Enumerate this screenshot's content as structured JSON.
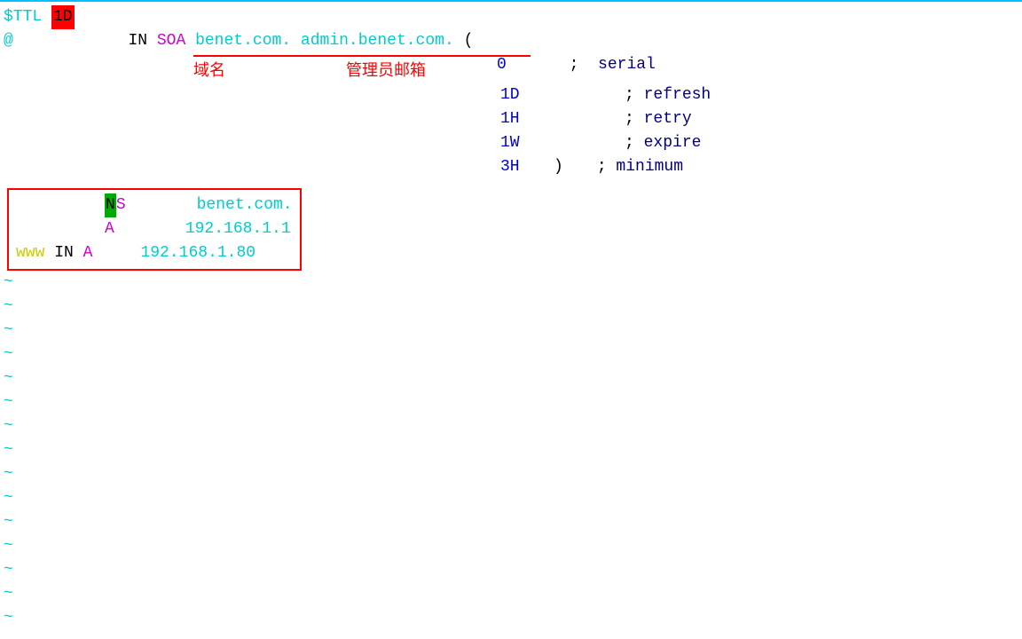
{
  "editor": {
    "border_color": "#00bfff",
    "ttl": {
      "directive": "$TTL",
      "value": "1D"
    },
    "soa": {
      "at": "@",
      "class": "IN",
      "type": "SOA",
      "domain": "benet.com.",
      "admin": "admin.benet.com.",
      "paren_open": "(",
      "annotation_domain": "域名",
      "annotation_email": "管理员邮箱"
    },
    "soa_params": [
      {
        "value": "0",
        "comment": "serial"
      },
      {
        "value": "1D",
        "comment": "refresh"
      },
      {
        "value": "1H",
        "comment": "retry"
      },
      {
        "value": "1W",
        "comment": "expire"
      },
      {
        "value": "3H",
        "paren_close": ")",
        "comment": "minimum"
      }
    ],
    "records": [
      {
        "name": "",
        "class": "",
        "type": "NS",
        "data": "benet.com.",
        "highlight_n": true
      },
      {
        "name": "",
        "class": "",
        "type": "A",
        "data": "192.168.1.1",
        "highlight_n": false
      },
      {
        "name": "www",
        "class": "IN",
        "type": "A",
        "data": "192.168.1.80",
        "highlight_n": false
      }
    ],
    "tildes": 15
  }
}
